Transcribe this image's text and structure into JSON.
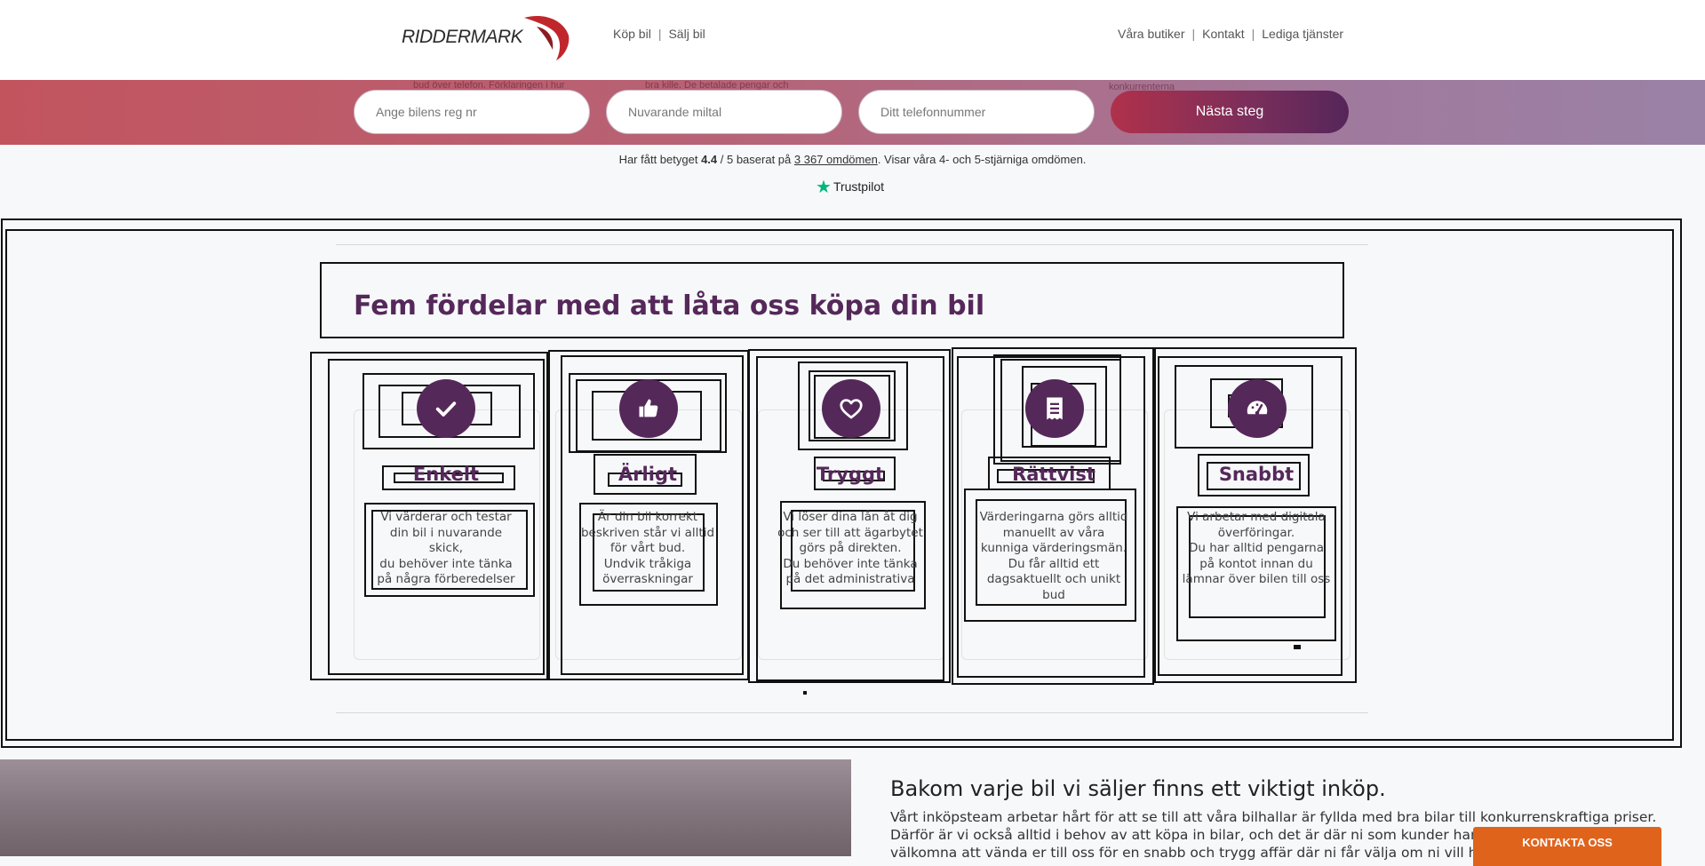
{
  "header": {
    "logo_text": "RIDDERMARK",
    "nav_left": [
      "Köp bil",
      "Sälj bil"
    ],
    "nav_right": [
      "Våra butiker",
      "Kontakt",
      "Lediga tjänster"
    ],
    "separator": "|"
  },
  "form": {
    "ghost_texts": [
      "bud över telefon. Förklaringen i hur",
      "bra kille. De betalade pengar och",
      "konkurrenterna"
    ],
    "reg_placeholder": "Ange bilens reg nr",
    "mileage_placeholder": "Nuvarande miltal",
    "phone_placeholder": "Ditt telefonnummer",
    "next_label": "Nästa steg"
  },
  "rating": {
    "prefix": "Har fått betyget ",
    "score": "4.4",
    "middle": " / 5 baserat på ",
    "count_link": "3 367 omdömen",
    "suffix": ". Visar våra 4- och 5-stjärniga omdömen.",
    "brand": "Trustpilot"
  },
  "benefits": {
    "title": "Fem fördelar med att låta oss köpa din bil",
    "cards": [
      {
        "icon": "check-icon",
        "title": "Enkelt",
        "text": "Vi värderar och testar\ndin bil i nuvarande skick,\ndu behöver inte tänka\npå några förberedelser"
      },
      {
        "icon": "thumbs-up-icon",
        "title": "Ärligt",
        "text": "Är din bil korrekt\nbeskriven står vi alltid\nför vårt bud.\nUndvik tråkiga\növerraskningar"
      },
      {
        "icon": "heart-icon",
        "title": "Tryggt",
        "text": "Vi löser dina lån åt dig\noch ser till att ägarbytet\ngörs på direkten.\nDu behöver inte tänka\npå det administrativa"
      },
      {
        "icon": "receipt-icon",
        "title": "Rättvist",
        "text": "Värderingarna görs alltid\nmanuellt av våra\nkunniga värderingsmän.\nDu får alltid ett\ndagsaktuellt och unikt\nbud"
      },
      {
        "icon": "speedometer-icon",
        "title": "Snabbt",
        "text": "Vi arbetar med digitala\növerföringar.\nDu har alltid pengarna\npå kontot innan du\nlämnar över bilen till oss"
      }
    ]
  },
  "about": {
    "title": "Bakom varje bil vi säljer finns ett viktigt inköp.",
    "lines": [
      "Vårt inköpsteam arbetar hårt för att se till att våra bilhallar är fyllda med bra bilar till konkurrenskraftiga priser.",
      "Därför är vi också alltid i behov av att köpa in bilar, och det är där ni som kunder har en",
      "välkomna att vända er till oss för en snabb och trygg affär där ni får välja om ni vill ha p"
    ]
  },
  "contact": {
    "label": "KONTAKTA OSS"
  },
  "colors": {
    "brand_purple": "#55285a",
    "contact_orange": "#e0631c",
    "trustpilot_green": "#00b67a"
  }
}
